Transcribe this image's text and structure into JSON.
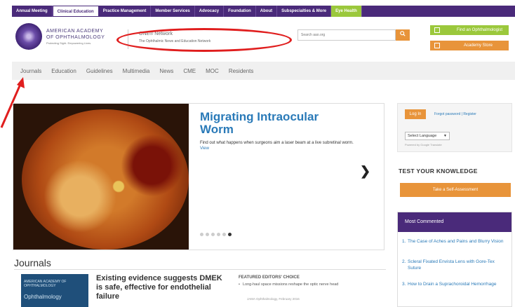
{
  "topnav": {
    "items": [
      {
        "label": "Annual Meeting"
      },
      {
        "label": "Clinical Education"
      },
      {
        "label": "Practice Management"
      },
      {
        "label": "Member Services"
      },
      {
        "label": "Advocacy"
      },
      {
        "label": "Foundation"
      },
      {
        "label": "About"
      },
      {
        "label": "Subspecialties & More"
      },
      {
        "label": "Eye Health"
      }
    ]
  },
  "header": {
    "logo_line1": "AMERICAN ACADEMY",
    "logo_line2": "OF OPHTHALMOLOGY",
    "logo_tagline": "Protecting Sight. Empowering Lives.",
    "network_name": "ONE® Network",
    "network_tagline": "The Ophthalmic News and Education Network",
    "search_placeholder": "Search aao.org",
    "find_button": "Find an Ophthalmologist",
    "store_button": "Academy Store"
  },
  "subnav": {
    "items": [
      {
        "label": "Journals"
      },
      {
        "label": "Education"
      },
      {
        "label": "Guidelines"
      },
      {
        "label": "Multimedia"
      },
      {
        "label": "News"
      },
      {
        "label": "CME"
      },
      {
        "label": "MOC"
      },
      {
        "label": "Residents"
      }
    ]
  },
  "hero": {
    "title": "Migrating Intraocular Worm",
    "description": "Find out what happens when surgeons aim a laser beam at a live subretinal worm.",
    "view_link": "View",
    "next_arrow": "❯",
    "slide_count": 6,
    "active_slide": 6
  },
  "journals": {
    "section_title": "Journals",
    "cover_small": "AMERICAN ACADEMY OF OPHTHALMOLOGY",
    "cover_title": "Ophthalmology",
    "headline": "Existing evidence suggests DMEK is safe, effective for endothelial failure",
    "featured_title": "FEATURED EDITORS' CHOICE",
    "featured_item": "Long-haul space missions reshape the optic nerve head",
    "featured_meta": "JAMA Ophthalmology, February 2016"
  },
  "sidebar": {
    "login_button": "Log In",
    "register_link": "Forgot password | Register",
    "language_select": "Select Language",
    "powered_by": "Powered by Google Translate",
    "test_title": "TEST YOUR KNOWLEDGE",
    "self_assessment_button": "Take a Self-Assessment",
    "most_commented_title": "Most Commented",
    "most_commented": [
      {
        "num": "1.",
        "label": "The Case of Aches and Pains and Blurry Vision"
      },
      {
        "num": "2.",
        "label": "Scleral Fixated Envista Lens with Gore-Tex Suture"
      },
      {
        "num": "3.",
        "label": "How to Drain a Suprachoroidal Hemorrhage"
      }
    ]
  },
  "colors": {
    "brand_purple": "#4a2a7a",
    "accent_orange": "#e8943a",
    "accent_green": "#9bc83c",
    "link_blue": "#2a7ab8",
    "annotation_red": "#e01e1e"
  }
}
